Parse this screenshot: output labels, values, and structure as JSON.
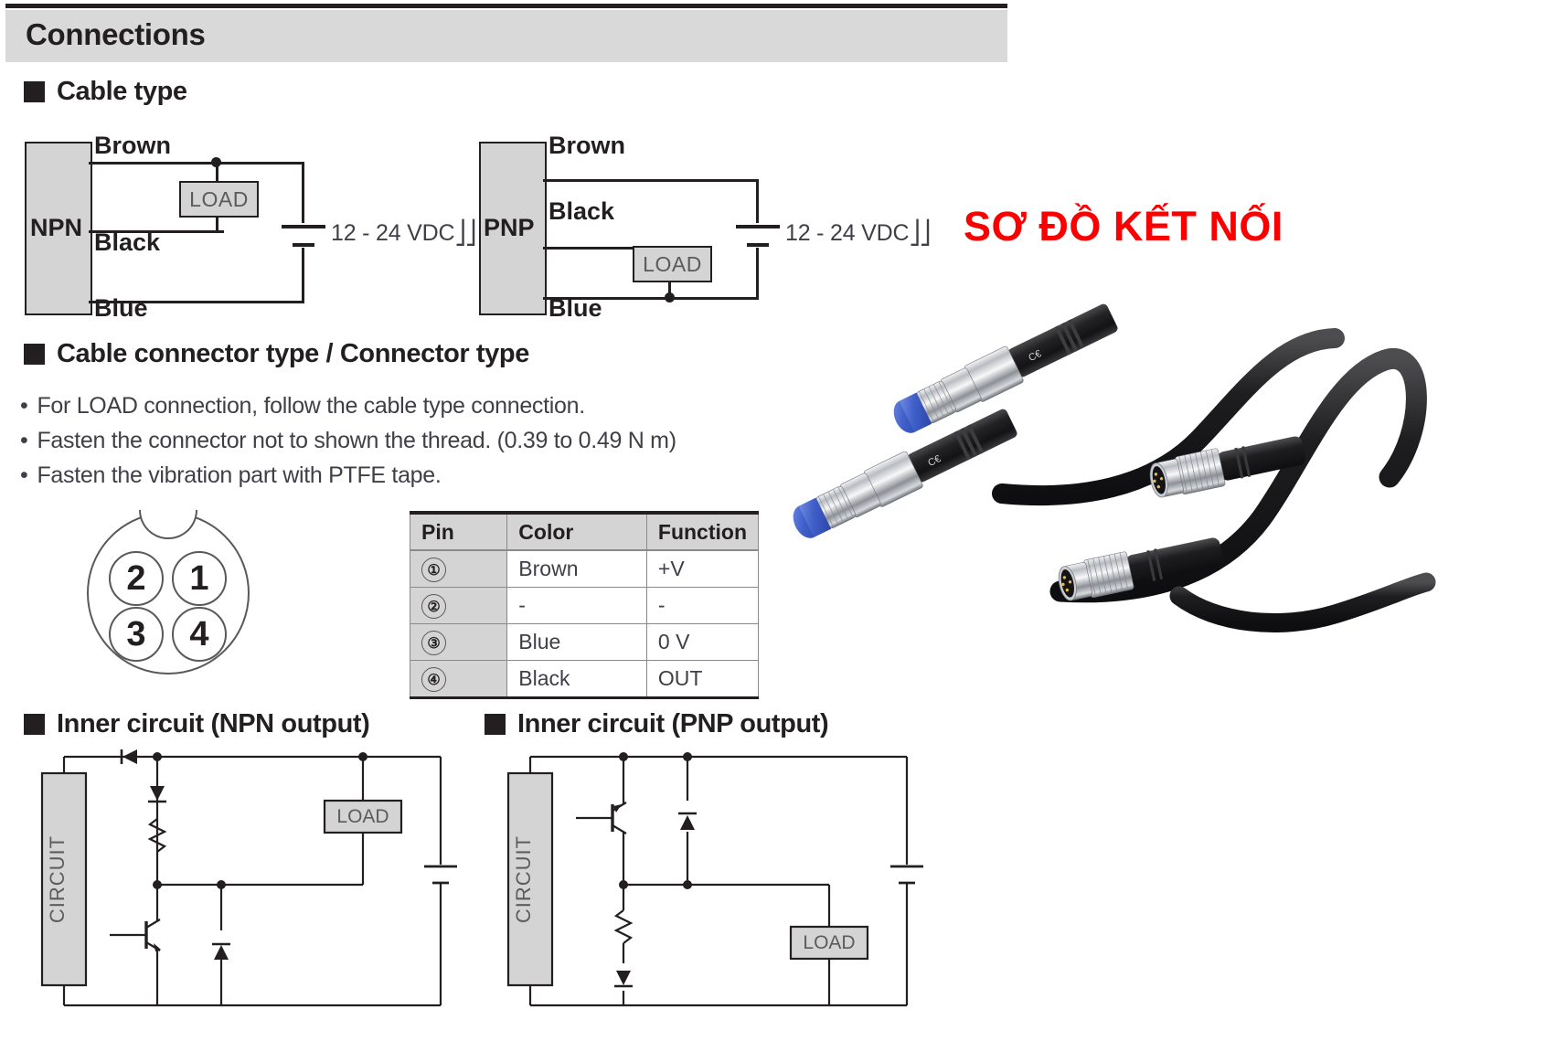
{
  "header": {
    "title": "Connections"
  },
  "overlay": {
    "text": "SƠ ĐỒ KẾT NỐI",
    "color": "#fa0000"
  },
  "sections": {
    "cable_type": {
      "title": "Cable type"
    },
    "connector_type": {
      "title": "Cable connector type / Connector type"
    },
    "inner_npn": {
      "title": "Inner circuit (NPN output)"
    },
    "inner_pnp": {
      "title": "Inner circuit (PNP output)"
    }
  },
  "cable_diagrams": [
    {
      "id": "npn",
      "body_label": "NPN",
      "wire_brown": "Brown",
      "wire_black": "Black",
      "wire_blue": "Blue",
      "load_label": "LOAD",
      "supply_label": "12 - 24 VDC",
      "supply_symbol": "⎓",
      "load_between": "Brown and Black"
    },
    {
      "id": "pnp",
      "body_label": "PNP",
      "wire_brown": "Brown",
      "wire_black": "Black",
      "wire_blue": "Blue",
      "load_label": "LOAD",
      "supply_label": "12 - 24 VDC",
      "supply_symbol": "⎓",
      "load_between": "Black and Blue"
    }
  ],
  "notes": [
    "For LOAD connection, follow the cable type connection.",
    "Fasten the connector not to shown the thread. (0.39 to 0.49 N m)",
    "Fasten the vibration part with PTFE tape."
  ],
  "bullet_marker": "•",
  "pin_layout": {
    "top_left": "2",
    "top_right": "1",
    "bottom_left": "3",
    "bottom_right": "4"
  },
  "pin_table": {
    "headers": [
      "Pin",
      "Color",
      "Function"
    ],
    "rows": [
      {
        "pin": "①",
        "color": "Brown",
        "function": "+V"
      },
      {
        "pin": "②",
        "color": "-",
        "function": "-"
      },
      {
        "pin": "③",
        "color": "Blue",
        "function": "0 V"
      },
      {
        "pin": "④",
        "color": "Black",
        "function": "OUT"
      }
    ]
  },
  "inner_circuits": [
    {
      "id": "npn",
      "block_label": "CIRCUIT",
      "load_label": "LOAD"
    },
    {
      "id": "pnp",
      "block_label": "CIRCUIT",
      "load_label": "LOAD"
    }
  ],
  "photo": {
    "alt": "Inductive proximity sensors with M12 cable connectors"
  }
}
